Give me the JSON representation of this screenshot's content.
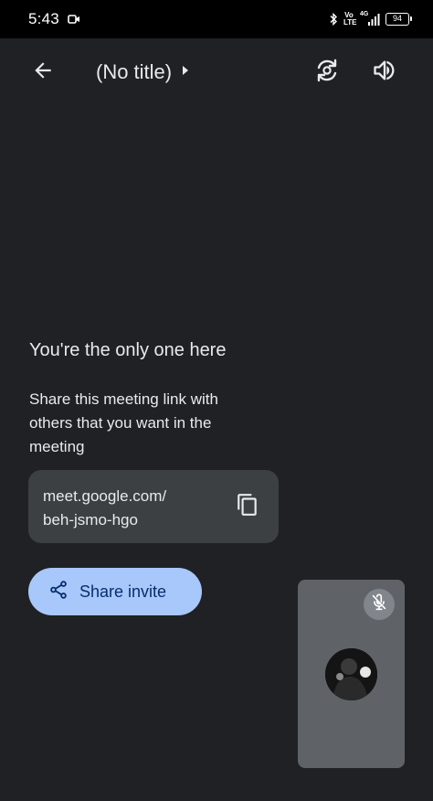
{
  "status_bar": {
    "time": "5:43",
    "volte_top": "Vo",
    "volte_bottom": "LTE",
    "network": "4G",
    "battery": "94"
  },
  "header": {
    "title": "(No title)"
  },
  "main": {
    "heading": "You're the only one here",
    "description": "Share this meeting link with others that you want in the meeting",
    "link_line1": "meet.google.com/",
    "link_line2": "beh-jsmo-hgo",
    "share_label": "Share invite"
  },
  "icons": {
    "back": "arrow-back-icon",
    "title_caret": "caret-right-icon",
    "flip_camera": "flip-camera-icon",
    "speaker": "volume-icon",
    "copy": "copy-icon",
    "share": "share-icon",
    "mic_off": "mic-off-icon"
  },
  "colors": {
    "background": "#202124",
    "card": "#3c4043",
    "share_button": "#a8c7fa",
    "share_text": "#062e6f",
    "tile": "#5f6368"
  }
}
